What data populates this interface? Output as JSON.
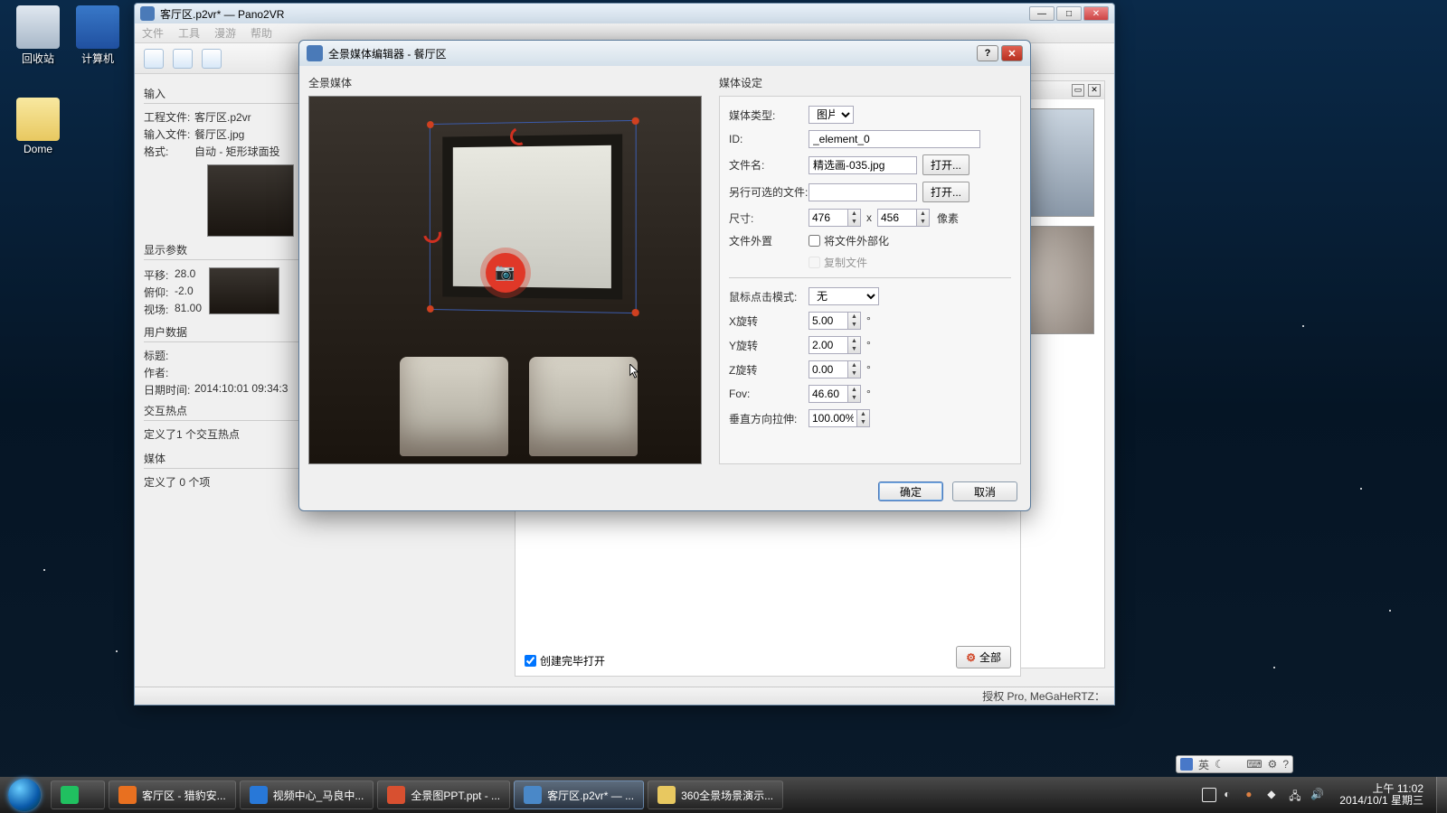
{
  "desktop": {
    "icons": [
      {
        "name": "回收站"
      },
      {
        "name": "计算机"
      },
      {
        "name": "Dome"
      }
    ]
  },
  "main_window": {
    "title": "客厅区.p2vr* — Pano2VR",
    "menus": [
      "文件",
      "工具",
      "漫游",
      "帮助"
    ],
    "input": {
      "header": "输入",
      "project_label": "工程文件:",
      "project_value": "客厅区.p2vr",
      "file_label": "输入文件:",
      "file_value": "餐厅区.jpg",
      "format_label": "格式:",
      "format_value": "自动 - 矩形球面投"
    },
    "view": {
      "header": "显示参数",
      "pan_label": "平移:",
      "pan_value": "28.0",
      "tilt_label": "俯仰:",
      "tilt_value": "-2.0",
      "fov_label": "视场:",
      "fov_value": "81.00"
    },
    "userdata": {
      "header": "用户数据",
      "title_label": "标题:",
      "author_label": "作者:",
      "date_label": "日期时间:",
      "date_value": "2014:10:01 09:34:3"
    },
    "hotspots": {
      "header": "交互热点",
      "text": "定义了1 个交互热点"
    },
    "media": {
      "header": "媒体",
      "text": "定义了 0 个项"
    },
    "open_after": "创建完毕打开",
    "all_btn": "全部",
    "status": "授权 Pro, MeGaHeRTZ："
  },
  "dialog": {
    "title": "全景媒体编辑器 - 餐厅区",
    "left_header": "全景媒体",
    "right_header": "媒体设定",
    "props": {
      "type_label": "媒体类型:",
      "type_value": "图片",
      "id_label": "ID:",
      "id_value": "_element_0",
      "file_label": "文件名:",
      "file_value": "精选画-035.jpg",
      "alt_label": "另行可选的文件:",
      "alt_value": "",
      "open_btn": "打开...",
      "size_label": "尺寸:",
      "size_w": "476",
      "size_h": "456",
      "size_unit": "像素",
      "size_x": "x",
      "ext_label": "文件外置",
      "ext_chk": "将文件外部化",
      "copy_chk": "复制文件",
      "click_label": "鼠标点击模式:",
      "click_value": "无",
      "rx_label": "X旋转",
      "rx_value": "5.00",
      "ry_label": "Y旋转",
      "ry_value": "2.00",
      "rz_label": "Z旋转",
      "rz_value": "0.00",
      "fov_label": "Fov:",
      "fov_value": "46.60",
      "stretch_label": "垂直方向拉伸:",
      "stretch_value": "100.00%",
      "deg": "°"
    },
    "ok": "确定",
    "cancel": "取消",
    "help": "?"
  },
  "taskbar": {
    "items": [
      {
        "label": "",
        "color": "#20c060"
      },
      {
        "label": "客厅区 - 猎豹安...",
        "color": "#e87020"
      },
      {
        "label": "视频中心_马良中...",
        "color": "#2878d8"
      },
      {
        "label": "全景图PPT.ppt - ...",
        "color": "#d85030"
      },
      {
        "label": "客厅区.p2vr* — ...",
        "color": "#4a88c8",
        "active": true
      },
      {
        "label": "360全景场景演示...",
        "color": "#e8c860"
      }
    ],
    "clock_time": "上午 11:02",
    "clock_date": "2014/10/1 星期三"
  },
  "ime": {
    "label": "英"
  }
}
